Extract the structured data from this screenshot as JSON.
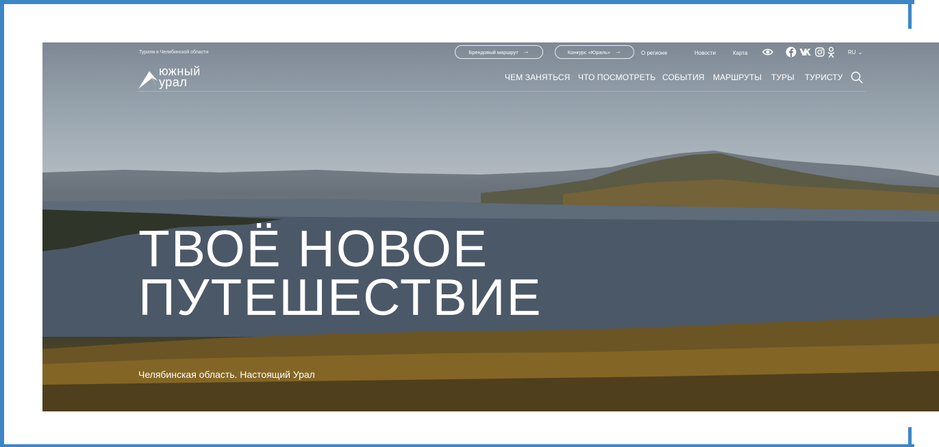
{
  "header": {
    "tagline": "Туризм в Челябинской области",
    "pills": [
      {
        "label": "Брендовый маршрут",
        "arrow": "→"
      },
      {
        "label": "Конкурс «Юраль»",
        "arrow": "→"
      }
    ],
    "links": [
      "О регионе",
      "Новости",
      "Карта"
    ],
    "icons": [
      "eye-icon",
      "facebook-icon",
      "vk-icon",
      "instagram-icon",
      "odnoklassniki-icon"
    ],
    "language": {
      "label": "RU",
      "chevron": "⌄"
    }
  },
  "logo": {
    "line1": "южный",
    "line2": "урал"
  },
  "nav": {
    "items": [
      "ЧЕМ ЗАНЯТЬСЯ",
      "ЧТО ПОСМОТРЕТЬ",
      "СОБЫТИЯ",
      "МАРШРУТЫ",
      "ТУРЫ",
      "ТУРИСТУ"
    ],
    "search_icon": "search-icon"
  },
  "hero": {
    "headline_line1": "ТВОЁ НОВОЕ",
    "headline_line2": "ПУТЕШЕСТВИЕ",
    "subtitle": "Челябинская область. Настоящий Урал"
  },
  "colors": {
    "frame": "#3d86c6",
    "text": "#ffffff"
  }
}
